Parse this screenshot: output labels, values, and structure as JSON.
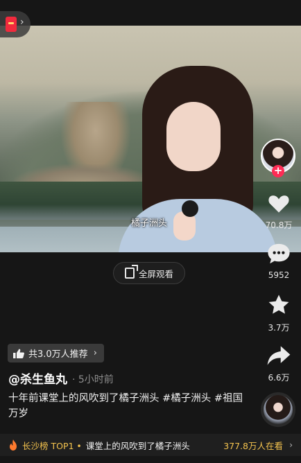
{
  "video": {
    "subtitle": "橘子洲头"
  },
  "topbar": {
    "red_packet_icon": "red-packet-icon",
    "chevron": "›"
  },
  "fullscreen_button": {
    "label": "全屏观看",
    "icon": "fullscreen-icon"
  },
  "actions": {
    "avatar_follow_symbol": "+",
    "likes": "70.8万",
    "comments": "5952",
    "favorites": "3.7万",
    "shares": "6.6万"
  },
  "recommend_badge": {
    "label": "共3.0万人推荐",
    "chevron": "›"
  },
  "post": {
    "author": "@杀生鱼丸",
    "time": "· 5小时前",
    "caption": "十年前课堂上的风吹到了橘子洲头 #橘子洲头 #祖国万岁"
  },
  "bottom_bar": {
    "rank": "长沙榜 TOP1 •",
    "title": "课堂上的风吹到了橘子洲头",
    "watching": "377.8万人在看",
    "chevron": "›"
  },
  "colors": {
    "accent_red": "#fe2c55",
    "rank_gold": "#f4c34e",
    "background": "#161616"
  }
}
